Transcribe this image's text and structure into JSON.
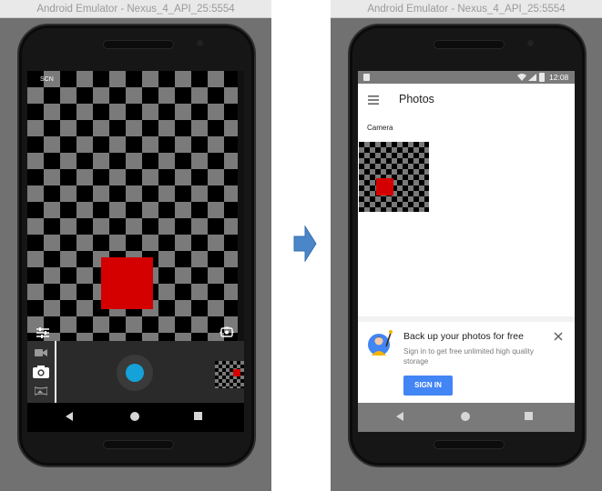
{
  "windows": [
    {
      "title": "Android Emulator - Nexus_4_API_25:5554"
    },
    {
      "title": "Android Emulator - Nexus_4_API_25:5554"
    }
  ],
  "camera_app": {
    "scene_label": "SCN",
    "modes": [
      "video-camera-icon",
      "photo-camera-icon",
      "panorama-icon"
    ],
    "shutter_color": "#14a2d8",
    "preview_square_color": "#d40000"
  },
  "photos_app": {
    "status_time": "12:08",
    "title": "Photos",
    "section": "Camera",
    "backup_title": "Back up your photos for free",
    "backup_desc": "Sign in to get free unlimited high quality storage",
    "signin_label": "SIGN IN",
    "accent": "#4285f4"
  }
}
